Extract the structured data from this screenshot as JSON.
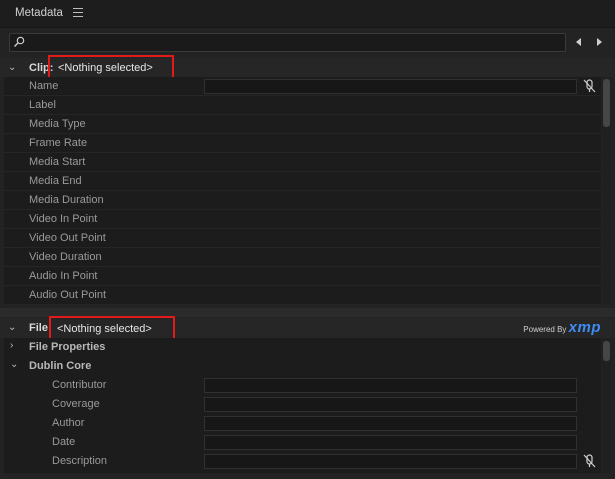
{
  "panel": {
    "title": "Metadata"
  },
  "search": {
    "placeholder": ""
  },
  "clip": {
    "label": "Clip:",
    "value": "<Nothing selected>",
    "fields": [
      "Name",
      "Label",
      "Media Type",
      "Frame Rate",
      "Media Start",
      "Media End",
      "Media Duration",
      "Video In Point",
      "Video Out Point",
      "Video Duration",
      "Audio In Point",
      "Audio Out Point"
    ]
  },
  "file": {
    "label": "File:",
    "value": "<Nothing selected>",
    "powered_by": "Powered By",
    "brand": "xmp",
    "groups": {
      "file_properties": "File Properties",
      "dublin_core": "Dublin Core"
    },
    "dublin_fields": [
      "Contributor",
      "Coverage",
      "Author",
      "Date",
      "Description"
    ]
  },
  "colors": {
    "highlight": "#e21a1a",
    "xmp_brand": "#3e8cf1"
  }
}
